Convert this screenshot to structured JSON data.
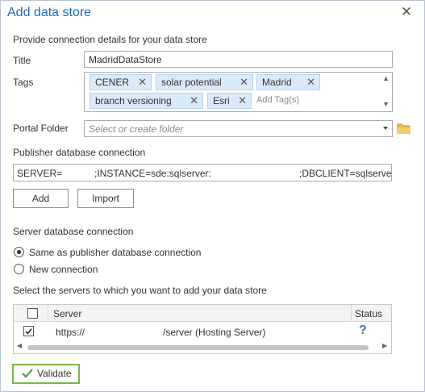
{
  "dialog": {
    "title": "Add data store",
    "close_glyph": "✕",
    "intro": "Provide connection details for your data store"
  },
  "title_field": {
    "label": "Title",
    "value": "MadridDataStore"
  },
  "tags": {
    "label": "Tags",
    "items": [
      "CENER",
      "solar potential",
      "Madrid",
      "branch versioning",
      "Esri"
    ],
    "remove_glyph": "✕",
    "placeholder": "Add Tag(s)",
    "scroll_up": "▲",
    "scroll_down": "▼"
  },
  "portal_folder": {
    "label": "Portal Folder",
    "placeholder": "Select or create folder",
    "icon": "folder-icon"
  },
  "publisher": {
    "label": "Publisher database connection",
    "segments": [
      "SERVER=",
      ";INSTANCE=sde:sqlserver:",
      ";DBCLIENT=sqlserver;"
    ],
    "add_label": "Add",
    "import_label": "Import"
  },
  "server_connection": {
    "label": "Server database connection",
    "options": [
      {
        "label": "Same as publisher database connection",
        "selected": true
      },
      {
        "label": "New connection",
        "selected": false
      }
    ]
  },
  "servers": {
    "label": "Select the servers to which you want to add your data store",
    "columns": {
      "server": "Server",
      "status": "Status"
    },
    "rows": [
      {
        "checked": true,
        "url_start": "https://",
        "url_end": "/server (Hosting Server)",
        "status": "?"
      }
    ],
    "scroll_left": "◀",
    "scroll_right": "▶"
  },
  "validate": {
    "label": "Validate",
    "icon": "checkmark-icon"
  },
  "colors": {
    "accent": "#1a6bb5",
    "tag_bg": "#dbeaf9",
    "validate_border": "#7ab648",
    "check_green": "#3c9a3a",
    "folder_yellow": "#e8b84a",
    "status_blue": "#4a6fb0"
  }
}
